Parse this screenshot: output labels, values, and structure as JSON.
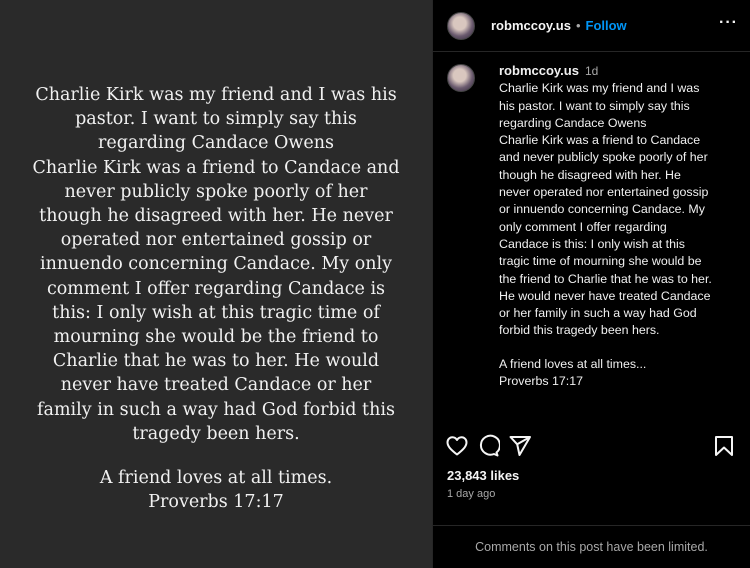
{
  "post_image": {
    "quote_lines": [
      "Charlie Kirk was my friend and I was his",
      "pastor. I want to simply say this",
      "regarding Candace Owens",
      "Charlie Kirk was a friend to Candace and",
      "never publicly spoke poorly of her",
      "though he disagreed with her. He never",
      "operated nor entertained gossip or",
      "innuendo concerning Candace. My only",
      "comment I offer regarding Candace is",
      "this: I only wish at this tragic time of",
      "mourning she would be the friend to",
      "Charlie that he was to her. He would",
      "never have treated Candace or her",
      "family in such a way had God forbid this",
      "tragedy been hers."
    ],
    "closing_lines": [
      "A friend loves at all times.",
      "Proverbs 17:17"
    ]
  },
  "header": {
    "username": "robmccoy.us",
    "separator": "•",
    "follow_label": "Follow",
    "more_label": "···"
  },
  "caption": {
    "username": "robmccoy.us",
    "time": "1d",
    "lines": [
      "Charlie Kirk was my friend and I was",
      "his pastor. I want to simply say this",
      "regarding Candace Owens",
      "Charlie Kirk was a friend to Candace",
      "and never publicly spoke poorly of her",
      "though he disagreed with her. He",
      "never operated nor entertained gossip",
      "or innuendo concerning Candace. My",
      "only comment I offer regarding",
      "Candace is this: I only wish at this",
      "tragic time of mourning she would be",
      "the friend to Charlie that he was to her.",
      "He would never have treated Candace",
      "or her family in such a way had God",
      "forbid this tragedy been hers."
    ],
    "closing_lines": [
      "A friend loves at all times...",
      "Proverbs 17:17"
    ]
  },
  "actions": {
    "icons": [
      "heart-icon",
      "comment-icon",
      "share-icon",
      "bookmark-icon"
    ]
  },
  "likes": "23,843 likes",
  "posted_ago": "1 day ago",
  "footer": {
    "comments_notice": "Comments on this post have been limited."
  }
}
